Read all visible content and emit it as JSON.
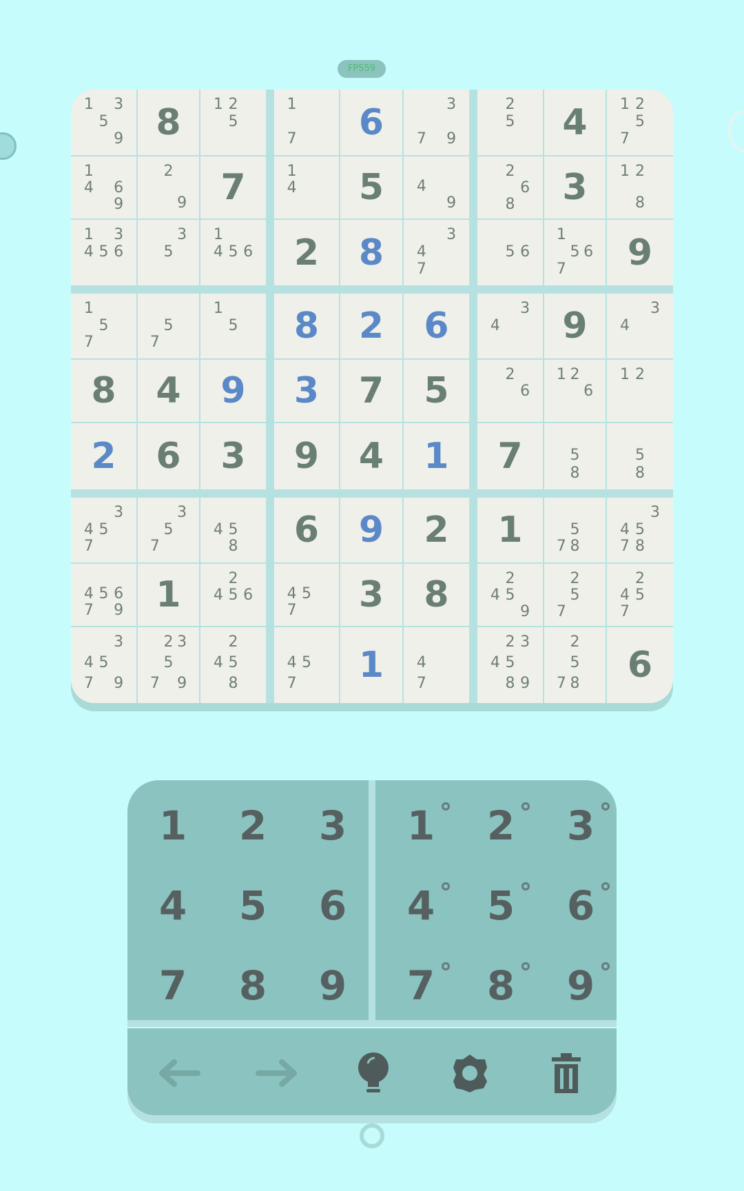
{
  "status": {
    "fps_label": "FPS59"
  },
  "colors": {
    "background": "#c6fdfc",
    "cell": "#f0f0eb",
    "given_digit": "#6a7f73",
    "entered_digit": "#5b88c7",
    "pad": "#8ac3c0"
  },
  "board": {
    "rows": [
      [
        {
          "notes": [
            1,
            3,
            5,
            9
          ]
        },
        {
          "value": 8,
          "type": "given"
        },
        {
          "notes": [
            1,
            2,
            5
          ]
        },
        {
          "notes": [
            1,
            7
          ]
        },
        {
          "value": 6,
          "type": "entered"
        },
        {
          "notes": [
            3,
            7,
            9
          ]
        },
        {
          "notes": [
            2,
            5
          ]
        },
        {
          "value": 4,
          "type": "given"
        },
        {
          "notes": [
            1,
            2,
            5,
            7
          ]
        }
      ],
      [
        {
          "notes": [
            1,
            4,
            6,
            9
          ]
        },
        {
          "notes": [
            2,
            9
          ]
        },
        {
          "value": 7,
          "type": "given"
        },
        {
          "notes": [
            1,
            4
          ]
        },
        {
          "value": 5,
          "type": "given"
        },
        {
          "notes": [
            4,
            9
          ]
        },
        {
          "notes": [
            2,
            6,
            8
          ]
        },
        {
          "value": 3,
          "type": "given"
        },
        {
          "notes": [
            1,
            2,
            8
          ]
        }
      ],
      [
        {
          "notes": [
            1,
            3,
            4,
            5,
            6
          ]
        },
        {
          "notes": [
            3,
            5
          ]
        },
        {
          "notes": [
            1,
            4,
            5,
            6
          ]
        },
        {
          "value": 2,
          "type": "given"
        },
        {
          "value": 8,
          "type": "entered"
        },
        {
          "notes": [
            3,
            4,
            7
          ]
        },
        {
          "notes": [
            5,
            6
          ]
        },
        {
          "notes": [
            1,
            5,
            6,
            7
          ]
        },
        {
          "value": 9,
          "type": "given"
        }
      ],
      [
        {
          "notes": [
            1,
            5,
            7
          ]
        },
        {
          "notes": [
            5,
            7
          ]
        },
        {
          "notes": [
            1,
            5
          ]
        },
        {
          "value": 8,
          "type": "entered"
        },
        {
          "value": 2,
          "type": "entered"
        },
        {
          "value": 6,
          "type": "entered"
        },
        {
          "notes": [
            3,
            4
          ]
        },
        {
          "value": 9,
          "type": "given"
        },
        {
          "notes": [
            3,
            4
          ]
        }
      ],
      [
        {
          "value": 8,
          "type": "given"
        },
        {
          "value": 4,
          "type": "given"
        },
        {
          "value": 9,
          "type": "entered"
        },
        {
          "value": 3,
          "type": "entered"
        },
        {
          "value": 7,
          "type": "given"
        },
        {
          "value": 5,
          "type": "given"
        },
        {
          "notes": [
            2,
            6
          ]
        },
        {
          "notes": [
            1,
            2,
            6
          ]
        },
        {
          "notes": [
            1,
            2
          ]
        }
      ],
      [
        {
          "value": 2,
          "type": "entered"
        },
        {
          "value": 6,
          "type": "given"
        },
        {
          "value": 3,
          "type": "given"
        },
        {
          "value": 9,
          "type": "given"
        },
        {
          "value": 4,
          "type": "given"
        },
        {
          "value": 1,
          "type": "entered"
        },
        {
          "value": 7,
          "type": "given"
        },
        {
          "notes": [
            5,
            8
          ]
        },
        {
          "notes": [
            5,
            8
          ]
        }
      ],
      [
        {
          "notes": [
            3,
            4,
            5,
            7
          ]
        },
        {
          "notes": [
            3,
            5,
            7
          ]
        },
        {
          "notes": [
            4,
            5,
            8
          ]
        },
        {
          "value": 6,
          "type": "given"
        },
        {
          "value": 9,
          "type": "entered"
        },
        {
          "value": 2,
          "type": "given"
        },
        {
          "value": 1,
          "type": "given"
        },
        {
          "notes": [
            5,
            7,
            8
          ]
        },
        {
          "notes": [
            3,
            4,
            5,
            7,
            8
          ]
        }
      ],
      [
        {
          "notes": [
            4,
            5,
            6,
            7,
            9
          ]
        },
        {
          "value": 1,
          "type": "given"
        },
        {
          "notes": [
            2,
            4,
            5,
            6
          ]
        },
        {
          "notes": [
            4,
            5,
            7
          ]
        },
        {
          "value": 3,
          "type": "given"
        },
        {
          "value": 8,
          "type": "given"
        },
        {
          "notes": [
            2,
            4,
            5,
            9
          ]
        },
        {
          "notes": [
            2,
            5,
            7
          ]
        },
        {
          "notes": [
            2,
            4,
            5,
            7
          ]
        }
      ],
      [
        {
          "notes": [
            3,
            4,
            5,
            7,
            9
          ]
        },
        {
          "notes": [
            2,
            3,
            5,
            7,
            9
          ]
        },
        {
          "notes": [
            2,
            4,
            5,
            8
          ]
        },
        {
          "notes": [
            4,
            5,
            7
          ]
        },
        {
          "value": 1,
          "type": "entered"
        },
        {
          "notes": [
            4,
            7
          ]
        },
        {
          "notes": [
            2,
            3,
            4,
            5,
            8,
            9
          ]
        },
        {
          "notes": [
            2,
            5,
            7,
            8
          ]
        },
        {
          "value": 6,
          "type": "given"
        }
      ]
    ]
  },
  "number_pad": {
    "digits": [
      "1",
      "2",
      "3",
      "4",
      "5",
      "6",
      "7",
      "8",
      "9"
    ],
    "note_digits": [
      "1",
      "2",
      "3",
      "4",
      "5",
      "6",
      "7",
      "8",
      "9"
    ]
  },
  "toolbar": {
    "icons": [
      "undo-arrow-icon",
      "redo-arrow-icon",
      "hint-bulb-icon",
      "settings-gear-icon",
      "delete-trash-icon"
    ]
  }
}
